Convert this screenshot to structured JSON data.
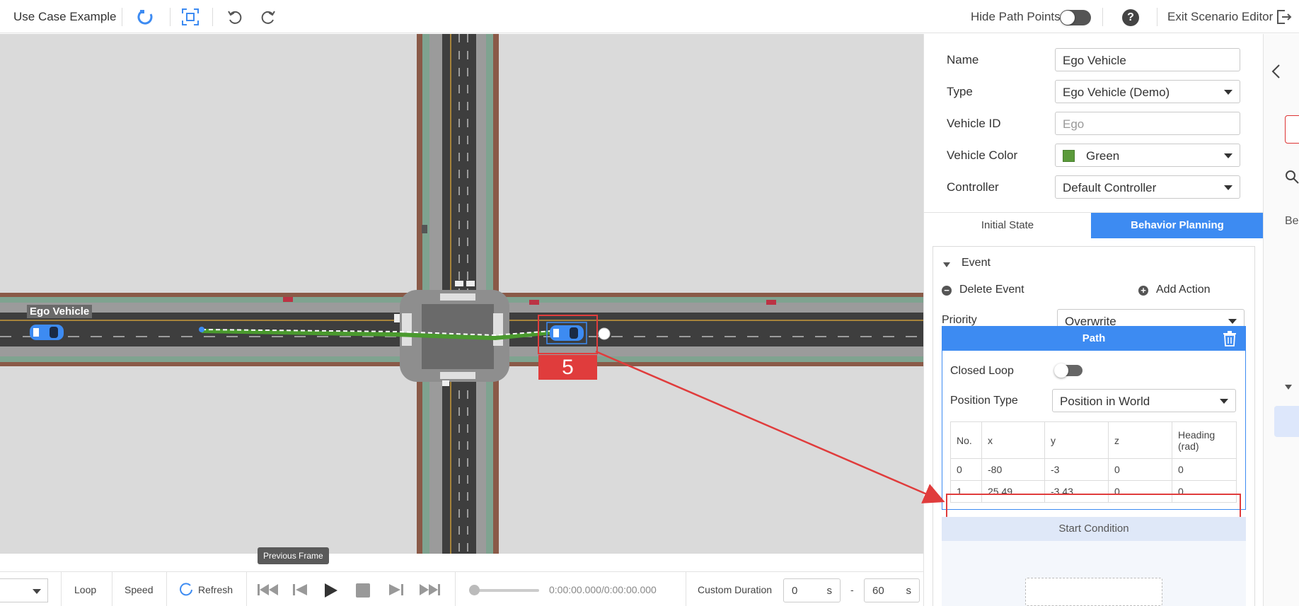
{
  "topbar": {
    "title": "Use Case Example",
    "icons": [
      "magnet-icon",
      "fit-view-icon",
      "undo-icon",
      "redo-icon"
    ],
    "hide_path_points_label": "Hide Path Points",
    "hide_path_points_on": false,
    "help_glyph": "?",
    "exit_label": "Exit Scenario Editor"
  },
  "map": {
    "ego_label": "Ego Vehicle",
    "tooltip": "Previous Frame",
    "annotation_number": "5"
  },
  "playback": {
    "loop_label": "Loop",
    "speed_label": "Speed",
    "refresh_label": "Refresh",
    "time_text": "0:00:00.000/0:00:00.000",
    "custom_duration_label": "Custom Duration",
    "duration_start": "0",
    "duration_start_unit": "s",
    "dash": "-",
    "duration_end": "60",
    "duration_end_unit": "s",
    "progress": 0
  },
  "panel": {
    "fields": {
      "name_label": "Name",
      "name_value": "Ego Vehicle",
      "type_label": "Type",
      "type_value": "Ego Vehicle (Demo)",
      "vehicle_id_label": "Vehicle ID",
      "vehicle_id_placeholder": "Ego",
      "vehicle_color_label": "Vehicle Color",
      "vehicle_color_value": "Green",
      "vehicle_color_hex": "#5a9a3a",
      "controller_label": "Controller",
      "controller_value": "Default Controller"
    },
    "tabs": {
      "initial_state": "Initial State",
      "behavior_planning": "Behavior Planning"
    },
    "event": {
      "title": "Event",
      "delete_label": "Delete Event",
      "add_action_label": "Add Action",
      "priority_label": "Priority",
      "priority_value": "Overwrite"
    },
    "path": {
      "header": "Path",
      "closed_loop_label": "Closed Loop",
      "closed_loop_on": false,
      "position_type_label": "Position Type",
      "position_type_value": "Position in World",
      "columns": [
        "No.",
        "x",
        "y",
        "z",
        "Heading (rad)"
      ],
      "rows": [
        [
          "0",
          "-80",
          "-3",
          "0",
          "0"
        ],
        [
          "1",
          "25.49",
          "-3.43",
          "0",
          "0"
        ]
      ]
    },
    "start_condition": "Start Condition"
  },
  "strip": {
    "partial_text": "Be"
  },
  "colors": {
    "accent": "#3d8bf2",
    "highlight": "#e03c3c",
    "path_green": "#4a9a2e"
  }
}
